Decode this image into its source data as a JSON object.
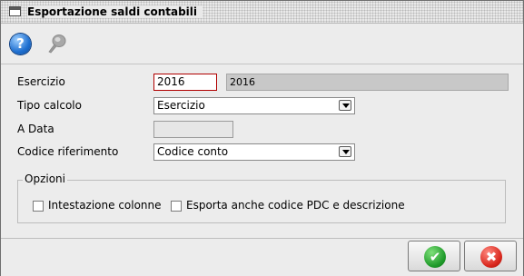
{
  "window": {
    "title": "Esportazione saldi contabili"
  },
  "toolbar": {
    "icons": [
      "help-icon",
      "pen-icon"
    ],
    "help_glyph": "?"
  },
  "form": {
    "esercizio": {
      "label": "Esercizio",
      "value": "2016",
      "description": "2016"
    },
    "tipo_calcolo": {
      "label": "Tipo calcolo",
      "value": "Esercizio"
    },
    "a_data": {
      "label": "A Data",
      "value": ""
    },
    "codice_riferimento": {
      "label": "Codice riferimento",
      "value": "Codice conto"
    }
  },
  "options": {
    "title": "Opzioni",
    "intestazione_colonne": {
      "label": "Intestazione colonne",
      "checked": false
    },
    "esporta_codice_pdc": {
      "label": "Esporta anche codice PDC e descrizione",
      "checked": false
    }
  },
  "footer": {
    "ok_icon": "check-icon",
    "ok_glyph": "✔",
    "cancel_icon": "cancel-icon",
    "cancel_glyph": "✖"
  },
  "colors": {
    "focus_border": "#b00000",
    "ok_green": "#1f9a2a",
    "cancel_red": "#d8261c",
    "help_blue": "#1e6fd0"
  }
}
